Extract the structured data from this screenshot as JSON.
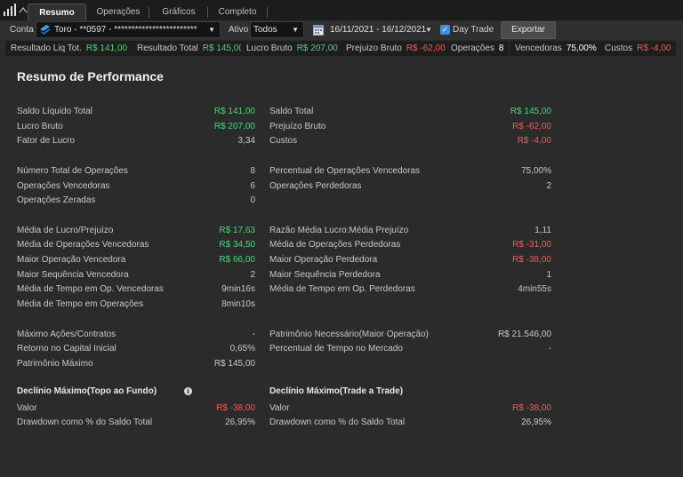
{
  "tabs": [
    {
      "label": "Resumo",
      "active": true
    },
    {
      "label": "Operações",
      "active": false
    },
    {
      "label": "Gráficos",
      "active": false
    },
    {
      "label": "Completo",
      "active": false
    }
  ],
  "filters": {
    "conta_label": "Conta",
    "conta_value": "Toro - **0597 - ************************",
    "ativo_label": "Ativo",
    "ativo_value": "Todos",
    "date_range": "16/11/2021 - 16/12/2021",
    "day_trade_label": "Day Trade",
    "day_trade_checked": true,
    "export_label": "Exportar"
  },
  "summary": [
    {
      "label": "Resultado Liq Tot.",
      "value": "R$ 141,00",
      "color": "#4cd37b"
    },
    {
      "label": "Resultado Total",
      "value": "R$ 145,00",
      "color": "#4cd37b"
    },
    {
      "label": "Lucro Bruto",
      "value": "R$ 207,00",
      "color": "#4cd37b"
    },
    {
      "label": "Prejuizo Bruto",
      "value": "R$ -62,00",
      "color": "#ee5a5a"
    },
    {
      "label": "Operações",
      "value": "8",
      "color": "#ffffff"
    },
    {
      "label": "Vencedoras",
      "value": "75,00%",
      "color": "#ffffff"
    },
    {
      "label": "Custos",
      "value": "R$ -4,00",
      "color": "#ee5a5a"
    }
  ],
  "title": "Resumo de Performance",
  "left": [
    {
      "label": "Saldo Líquido Total",
      "value": "R$ 141,00",
      "c": "g"
    },
    {
      "label": "Lucro Bruto",
      "value": "R$ 207,00",
      "c": "g"
    },
    {
      "label": "Fator de Lucro",
      "value": "3,34",
      "c": "n"
    },
    {
      "label": "Número Total de Operações",
      "value": "8",
      "c": "n"
    },
    {
      "label": "Operações Vencedoras",
      "value": "6",
      "c": "n"
    },
    {
      "label": "Operações Zeradas",
      "value": "0",
      "c": "n"
    },
    {
      "label": "Média de Lucro/Prejuízo",
      "value": "R$ 17,63",
      "c": "g"
    },
    {
      "label": "Média de Operações Vencedoras",
      "value": "R$ 34,50",
      "c": "g"
    },
    {
      "label": "Maior Operação Vencedora",
      "value": "R$ 66,00",
      "c": "g"
    },
    {
      "label": "Maior Sequência Vencedora",
      "value": "2",
      "c": "n"
    },
    {
      "label": "Média de Tempo em Op. Vencedoras",
      "value": "9min16s",
      "c": "n"
    },
    {
      "label": "Média de Tempo em Operações",
      "value": "8min10s",
      "c": "n"
    },
    {
      "label": "Máximo Ações/Contratos",
      "value": "-",
      "c": "n"
    },
    {
      "label": "Retorno no Capital Inicial",
      "value": "0,65%",
      "c": "n"
    },
    {
      "label": "Patrimônio Máximo",
      "value": "R$ 145,00",
      "c": "n"
    }
  ],
  "right": [
    {
      "label": "Saldo Total",
      "value": "R$ 145,00",
      "c": "g"
    },
    {
      "label": "Prejuízo Bruto",
      "value": "R$ -62,00",
      "c": "r"
    },
    {
      "label": "Custos",
      "value": "R$ -4,00",
      "c": "r"
    },
    {
      "label": "Percentual de Operações Vencedoras",
      "value": "75,00%",
      "c": "n"
    },
    {
      "label": "Operações Perdedoras",
      "value": "2",
      "c": "n"
    },
    {
      "label": "Razão Média Lucro:Média Prejuízo",
      "value": "1,11",
      "c": "n"
    },
    {
      "label": "Média de Operações Perdedoras",
      "value": "R$ -31,00",
      "c": "r"
    },
    {
      "label": "Maior Operação Perdedora",
      "value": "R$ -38,00",
      "c": "r"
    },
    {
      "label": "Maior Sequência Perdedora",
      "value": "1",
      "c": "n"
    },
    {
      "label": "Média de Tempo em Op. Perdedoras",
      "value": "4min55s",
      "c": "n"
    },
    {
      "label": "Patrimônio Necessário(Maior Operação)",
      "value": "R$ 21.546,00",
      "c": "n"
    },
    {
      "label": "Percentual de Tempo no Mercado",
      "value": "-",
      "c": "n"
    }
  ],
  "drawdown_left": {
    "title": "Declínio Máximo(Topo ao Fundo)",
    "rows": [
      {
        "label": "Valor",
        "value": "R$ -38,00",
        "c": "r"
      },
      {
        "label": "Drawdown como % do Saldo Total",
        "value": "26,95%",
        "c": "n"
      }
    ]
  },
  "drawdown_right": {
    "title": "Declínio Máximo(Trade a Trade)",
    "rows": [
      {
        "label": "Valor",
        "value": "R$ -38,00",
        "c": "r"
      },
      {
        "label": "Drawdown como % do Saldo Total",
        "value": "26,95%",
        "c": "n"
      }
    ]
  },
  "icons": {
    "logo": "bar-chart-logo-icon",
    "calendar": "calendar-icon",
    "info": "info-icon",
    "broker": "broker-logo-icon"
  }
}
